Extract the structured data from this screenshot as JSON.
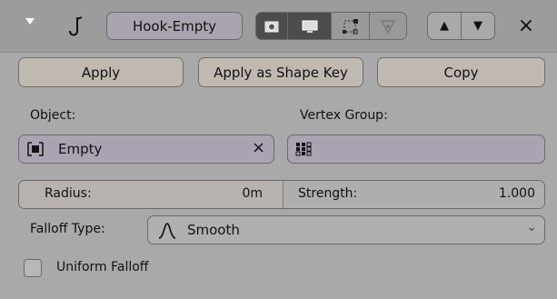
{
  "header": {
    "modifier_name": "Hook-Empty",
    "close_glyph": "×",
    "move_up_glyph": "▲",
    "move_down_glyph": "▼"
  },
  "actions": {
    "apply_label": "Apply",
    "apply_shape_key_label": "Apply as Shape Key",
    "copy_label": "Copy"
  },
  "object": {
    "label": "Object:",
    "value": "Empty",
    "clear_glyph": "×"
  },
  "vertex_group": {
    "label": "Vertex Group:",
    "value": ""
  },
  "radius": {
    "label": "Radius:",
    "value": "0m"
  },
  "strength": {
    "label": "Strength:",
    "value": "1.000"
  },
  "falloff": {
    "label": "Falloff Type:",
    "value": "Smooth",
    "dropdown_glyph": "⌄"
  },
  "uniform_falloff": {
    "label": "Uniform Falloff",
    "checked": false
  },
  "colors": {
    "panel_bg": "#a9a9a9",
    "header_bg": "#9c9c9c",
    "button_bg": "#c0b9b2",
    "field_bg": "#aaa3b2",
    "toggle_active": "#4c4c4c"
  },
  "icons": [
    "expand-triangle-icon",
    "hook-icon",
    "render-icon",
    "viewport-icon",
    "edit-mode-icon",
    "cage-icon",
    "move-up-icon",
    "move-down-icon",
    "close-icon",
    "object-icon",
    "vertex-group-icon",
    "smooth-falloff-icon",
    "dropdown-icon"
  ]
}
